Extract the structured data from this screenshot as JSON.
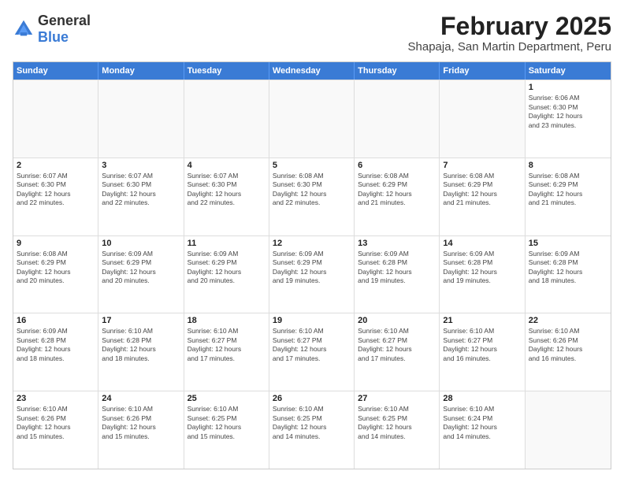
{
  "logo": {
    "general": "General",
    "blue": "Blue"
  },
  "title": "February 2025",
  "subtitle": "Shapaja, San Martin Department, Peru",
  "header_days": [
    "Sunday",
    "Monday",
    "Tuesday",
    "Wednesday",
    "Thursday",
    "Friday",
    "Saturday"
  ],
  "weeks": [
    [
      {
        "day": "",
        "info": "",
        "empty": true
      },
      {
        "day": "",
        "info": "",
        "empty": true
      },
      {
        "day": "",
        "info": "",
        "empty": true
      },
      {
        "day": "",
        "info": "",
        "empty": true
      },
      {
        "day": "",
        "info": "",
        "empty": true
      },
      {
        "day": "",
        "info": "",
        "empty": true
      },
      {
        "day": "1",
        "info": "Sunrise: 6:06 AM\nSunset: 6:30 PM\nDaylight: 12 hours\nand 23 minutes.",
        "empty": false
      }
    ],
    [
      {
        "day": "2",
        "info": "Sunrise: 6:07 AM\nSunset: 6:30 PM\nDaylight: 12 hours\nand 22 minutes.",
        "empty": false
      },
      {
        "day": "3",
        "info": "Sunrise: 6:07 AM\nSunset: 6:30 PM\nDaylight: 12 hours\nand 22 minutes.",
        "empty": false
      },
      {
        "day": "4",
        "info": "Sunrise: 6:07 AM\nSunset: 6:30 PM\nDaylight: 12 hours\nand 22 minutes.",
        "empty": false
      },
      {
        "day": "5",
        "info": "Sunrise: 6:08 AM\nSunset: 6:30 PM\nDaylight: 12 hours\nand 22 minutes.",
        "empty": false
      },
      {
        "day": "6",
        "info": "Sunrise: 6:08 AM\nSunset: 6:29 PM\nDaylight: 12 hours\nand 21 minutes.",
        "empty": false
      },
      {
        "day": "7",
        "info": "Sunrise: 6:08 AM\nSunset: 6:29 PM\nDaylight: 12 hours\nand 21 minutes.",
        "empty": false
      },
      {
        "day": "8",
        "info": "Sunrise: 6:08 AM\nSunset: 6:29 PM\nDaylight: 12 hours\nand 21 minutes.",
        "empty": false
      }
    ],
    [
      {
        "day": "9",
        "info": "Sunrise: 6:08 AM\nSunset: 6:29 PM\nDaylight: 12 hours\nand 20 minutes.",
        "empty": false
      },
      {
        "day": "10",
        "info": "Sunrise: 6:09 AM\nSunset: 6:29 PM\nDaylight: 12 hours\nand 20 minutes.",
        "empty": false
      },
      {
        "day": "11",
        "info": "Sunrise: 6:09 AM\nSunset: 6:29 PM\nDaylight: 12 hours\nand 20 minutes.",
        "empty": false
      },
      {
        "day": "12",
        "info": "Sunrise: 6:09 AM\nSunset: 6:29 PM\nDaylight: 12 hours\nand 19 minutes.",
        "empty": false
      },
      {
        "day": "13",
        "info": "Sunrise: 6:09 AM\nSunset: 6:28 PM\nDaylight: 12 hours\nand 19 minutes.",
        "empty": false
      },
      {
        "day": "14",
        "info": "Sunrise: 6:09 AM\nSunset: 6:28 PM\nDaylight: 12 hours\nand 19 minutes.",
        "empty": false
      },
      {
        "day": "15",
        "info": "Sunrise: 6:09 AM\nSunset: 6:28 PM\nDaylight: 12 hours\nand 18 minutes.",
        "empty": false
      }
    ],
    [
      {
        "day": "16",
        "info": "Sunrise: 6:09 AM\nSunset: 6:28 PM\nDaylight: 12 hours\nand 18 minutes.",
        "empty": false
      },
      {
        "day": "17",
        "info": "Sunrise: 6:10 AM\nSunset: 6:28 PM\nDaylight: 12 hours\nand 18 minutes.",
        "empty": false
      },
      {
        "day": "18",
        "info": "Sunrise: 6:10 AM\nSunset: 6:27 PM\nDaylight: 12 hours\nand 17 minutes.",
        "empty": false
      },
      {
        "day": "19",
        "info": "Sunrise: 6:10 AM\nSunset: 6:27 PM\nDaylight: 12 hours\nand 17 minutes.",
        "empty": false
      },
      {
        "day": "20",
        "info": "Sunrise: 6:10 AM\nSunset: 6:27 PM\nDaylight: 12 hours\nand 17 minutes.",
        "empty": false
      },
      {
        "day": "21",
        "info": "Sunrise: 6:10 AM\nSunset: 6:27 PM\nDaylight: 12 hours\nand 16 minutes.",
        "empty": false
      },
      {
        "day": "22",
        "info": "Sunrise: 6:10 AM\nSunset: 6:26 PM\nDaylight: 12 hours\nand 16 minutes.",
        "empty": false
      }
    ],
    [
      {
        "day": "23",
        "info": "Sunrise: 6:10 AM\nSunset: 6:26 PM\nDaylight: 12 hours\nand 15 minutes.",
        "empty": false
      },
      {
        "day": "24",
        "info": "Sunrise: 6:10 AM\nSunset: 6:26 PM\nDaylight: 12 hours\nand 15 minutes.",
        "empty": false
      },
      {
        "day": "25",
        "info": "Sunrise: 6:10 AM\nSunset: 6:25 PM\nDaylight: 12 hours\nand 15 minutes.",
        "empty": false
      },
      {
        "day": "26",
        "info": "Sunrise: 6:10 AM\nSunset: 6:25 PM\nDaylight: 12 hours\nand 14 minutes.",
        "empty": false
      },
      {
        "day": "27",
        "info": "Sunrise: 6:10 AM\nSunset: 6:25 PM\nDaylight: 12 hours\nand 14 minutes.",
        "empty": false
      },
      {
        "day": "28",
        "info": "Sunrise: 6:10 AM\nSunset: 6:24 PM\nDaylight: 12 hours\nand 14 minutes.",
        "empty": false
      },
      {
        "day": "",
        "info": "",
        "empty": true
      }
    ]
  ]
}
